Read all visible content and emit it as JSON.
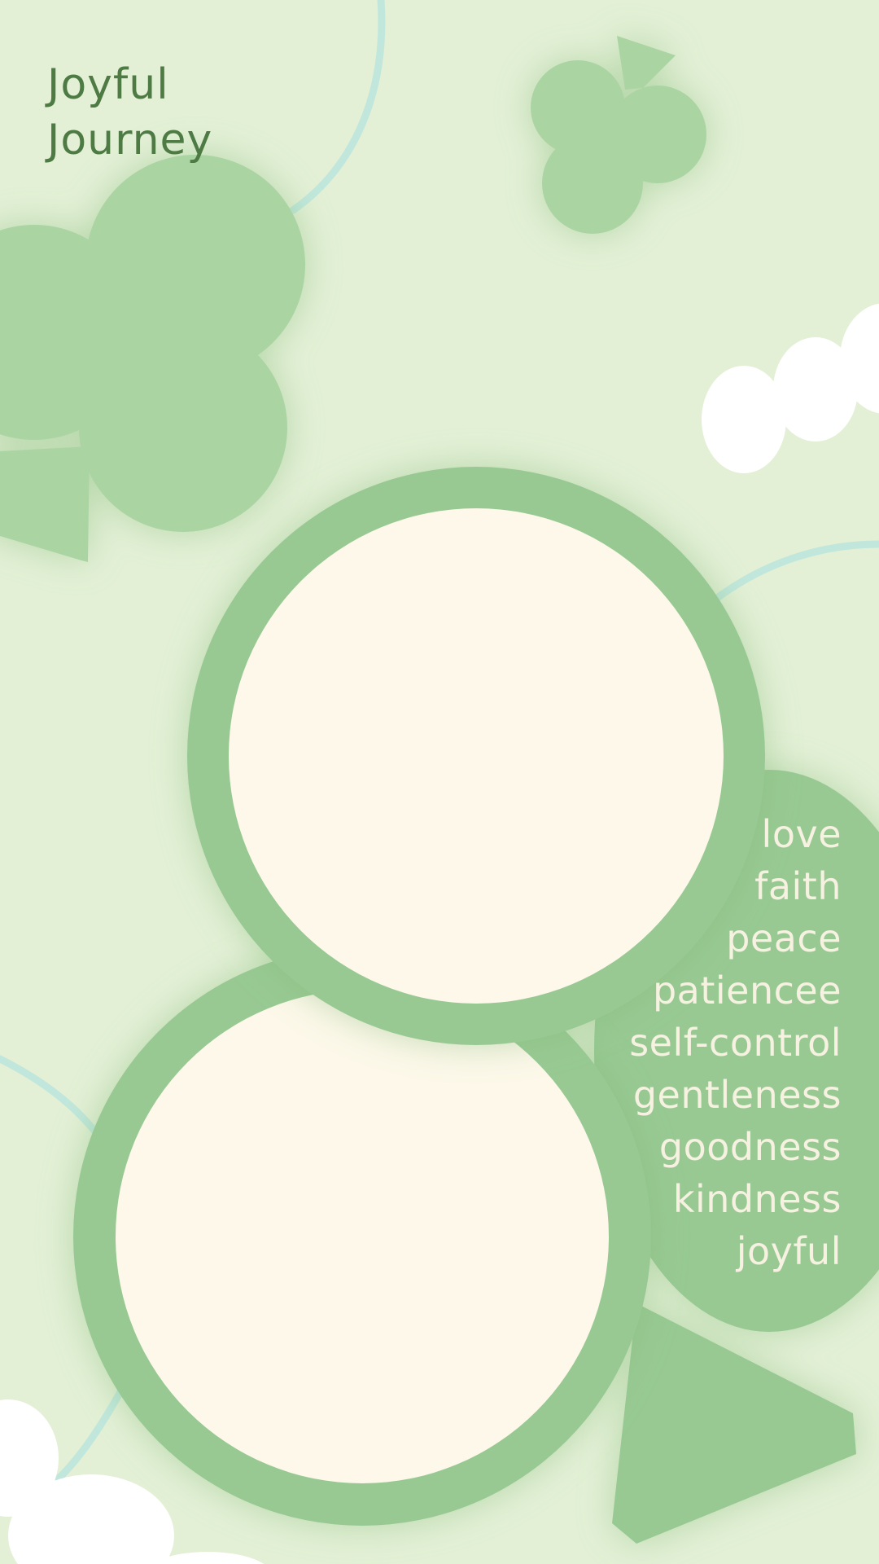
{
  "title": {
    "line1": "Joyful",
    "line2": "Journey"
  },
  "virtues": [
    "love",
    "faith",
    "peace",
    "patiencee",
    "self-control",
    "gentleness",
    "goodness",
    "kindness",
    "joyful"
  ],
  "colors": {
    "background": "#e3f0d6",
    "clover": "#abd4a3",
    "ring": "#98c993",
    "photo_fill": "#fdf8ea",
    "line": "#c1e7dc",
    "cloud": "#ffffff",
    "title_text": "#4e7a44",
    "word_text": "#f6f1e0"
  },
  "icons": {
    "clover_large": "clover-icon",
    "clover_small": "clover-icon",
    "cloud": "cloud-icon"
  }
}
